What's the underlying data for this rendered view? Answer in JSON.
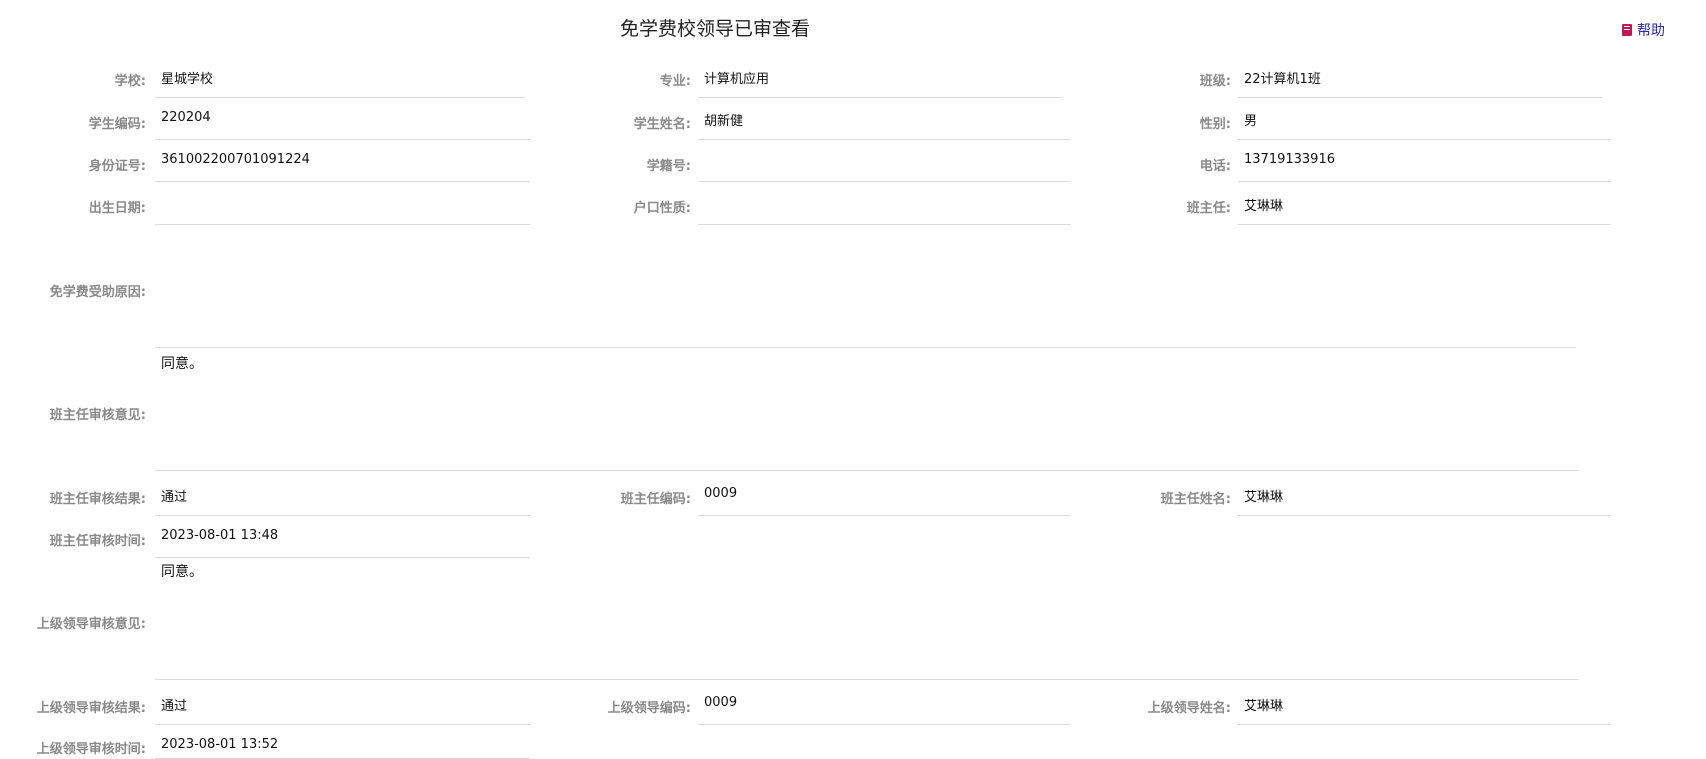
{
  "page": {
    "title": "免学费校领导已审查看",
    "help_label": "帮助"
  },
  "rows": [
    [
      {
        "label": "学校:",
        "value": "星城学校"
      },
      {
        "label": "专业:",
        "value": "计算机应用"
      },
      {
        "label": "班级:",
        "value": "22计算机1班"
      }
    ],
    [
      {
        "label": "学生编码:",
        "value": "220204"
      },
      {
        "label": "学生姓名:",
        "value": "胡新健"
      },
      {
        "label": "性别:",
        "value": "男"
      }
    ],
    [
      {
        "label": "身份证号:",
        "value": "361002200701091224"
      },
      {
        "label": "学籍号:",
        "value": ""
      },
      {
        "label": "电话:",
        "value": "13719133916"
      }
    ],
    [
      {
        "label": "出生日期:",
        "value": ""
      },
      {
        "label": "户口性质:",
        "value": ""
      },
      {
        "label": "班主任:",
        "value": "艾琳琳"
      }
    ]
  ],
  "reason": {
    "label": "免学费受助原因:",
    "value": ""
  },
  "teacher_opinion": {
    "label": "班主任审核意见:",
    "value": "同意。"
  },
  "teacher_result": [
    {
      "label": "班主任审核结果:",
      "value": "通过"
    },
    {
      "label": "班主任编码:",
      "value": "0009"
    },
    {
      "label": "班主任姓名:",
      "value": "艾琳琳"
    }
  ],
  "teacher_time": {
    "label": "班主任审核时间:",
    "value": "2023-08-01 13:48"
  },
  "leader_opinion": {
    "label": "上级领导审核意见:",
    "value": "同意。"
  },
  "leader_result": [
    {
      "label": "上级领导审核结果:",
      "value": "通过"
    },
    {
      "label": "上级领导编码:",
      "value": "0009"
    },
    {
      "label": "上级领导姓名:",
      "value": "艾琳琳"
    }
  ],
  "leader_time": {
    "label": "上级领导审核时间:",
    "value": "2023-08-01 13:52"
  }
}
